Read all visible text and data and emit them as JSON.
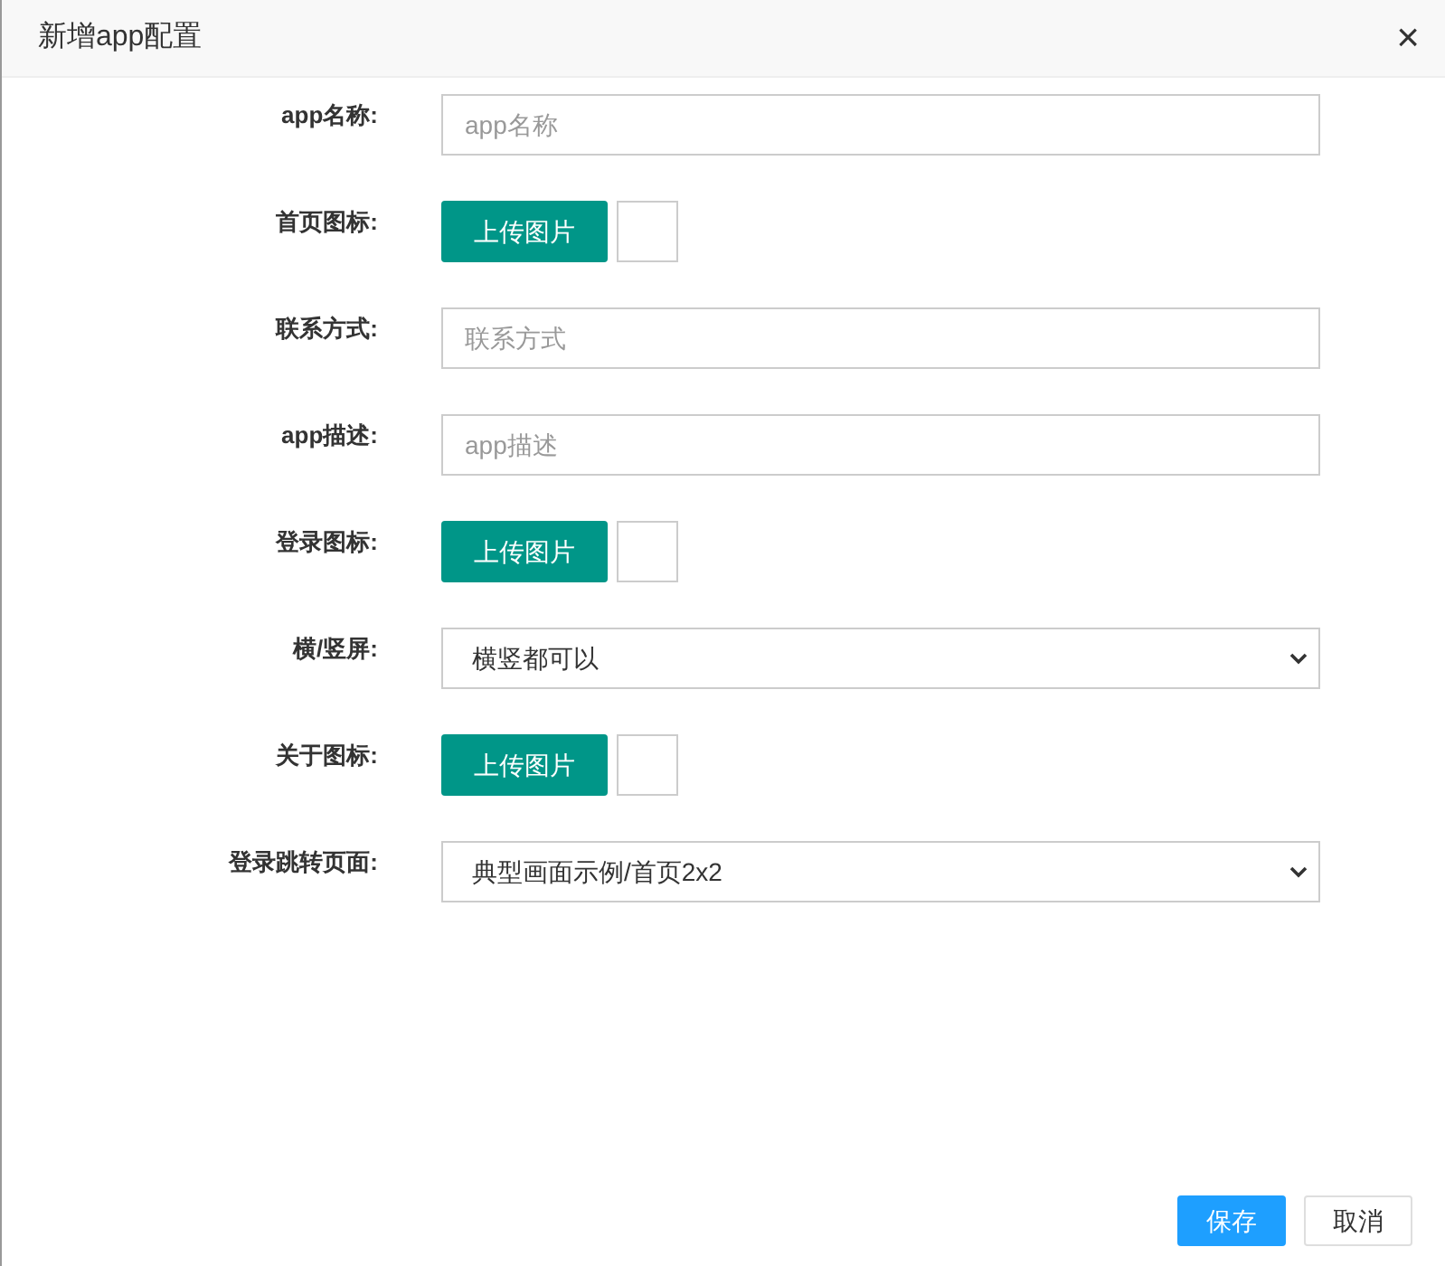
{
  "window": {
    "title": "新增app配置",
    "close": "×"
  },
  "fields": [
    {
      "kind": "text",
      "label": "app名称:",
      "placeholder": "app名称"
    },
    {
      "kind": "upload",
      "label": "首页图标:",
      "button": "上传图片"
    },
    {
      "kind": "text",
      "label": "联系方式:",
      "placeholder": "联系方式"
    },
    {
      "kind": "text",
      "label": "app描述:",
      "placeholder": "app描述"
    },
    {
      "kind": "upload",
      "label": "登录图标:",
      "button": "上传图片"
    },
    {
      "kind": "select",
      "label": "横/竖屏:",
      "value": "横竖都可以"
    },
    {
      "kind": "upload",
      "label": "关于图标:",
      "button": "上传图片"
    },
    {
      "kind": "select",
      "label": "登录跳转页面:",
      "value": "典型画面示例/首页2x2"
    }
  ],
  "buttons": [
    {
      "kind": "primary",
      "label": "保存"
    },
    {
      "kind": "default",
      "label": "取消"
    }
  ]
}
